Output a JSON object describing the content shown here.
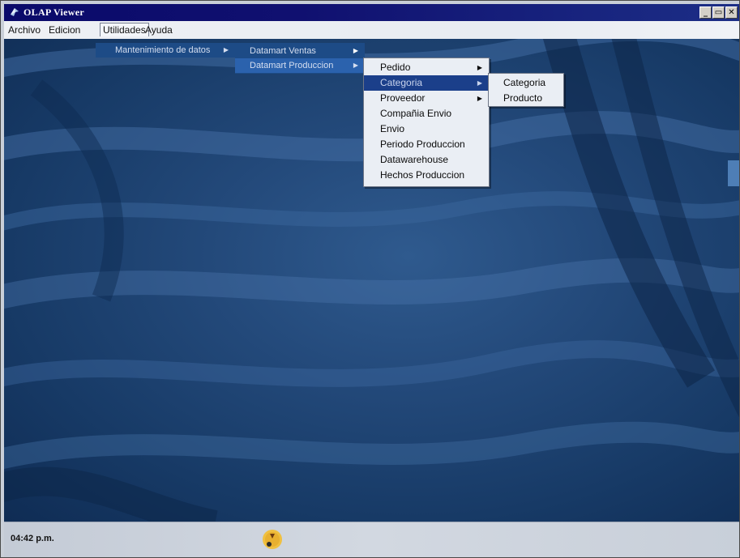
{
  "window": {
    "title": "OLAP Viewer"
  },
  "titlebar_buttons": {
    "minimize": "_",
    "restore": "▭",
    "close": "✕"
  },
  "menubar": [
    "Archivo",
    "Edicion",
    "Utilidades",
    "Ayuda"
  ],
  "menu_utilidades": {
    "item": "Mantenimiento de datos",
    "arrow": "▶"
  },
  "menu_mantenimiento": {
    "items": [
      "Datamart Ventas",
      "Datamart Produccion"
    ],
    "arrow": "▶"
  },
  "menu_produccion": {
    "items": [
      "Pedido",
      "Categoria",
      "Proveedor",
      "Compañia Envio",
      "Envio",
      "Periodo Produccion",
      "Datawarehouse",
      "Hechos Produccion"
    ],
    "arrows": [
      "▶",
      "▶",
      "▶"
    ]
  },
  "menu_categoria": {
    "items": [
      "Categoria",
      "Producto"
    ]
  },
  "statusbar": {
    "time": "04:42 p.m."
  },
  "colors": {
    "titlebar": "#0a0a6a",
    "selection": "#1b3f8a",
    "desktop": "#23497a"
  }
}
